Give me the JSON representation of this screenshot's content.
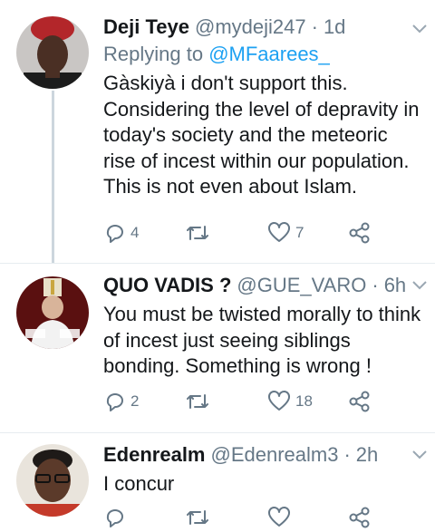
{
  "tweets": [
    {
      "name": "Deji Teye",
      "handle": "@mydeji247",
      "time": "1d",
      "replying_prefix": "Replying to ",
      "replying_handle": "@MFaarees_",
      "text": "Gàskiyà i don't support this. Considering the level of depravity in today's society and the meteoric rise of incest within our population. This is not even about Islam.",
      "replies": "4",
      "retweets": "",
      "likes": "7"
    },
    {
      "name": "QUO VADIS ?",
      "handle": "@GUE_VARO",
      "time": "6h",
      "text": "You must be twisted morally to think of incest just seeing siblings bonding.  Something is wrong !",
      "replies": "2",
      "retweets": "",
      "likes": "18"
    },
    {
      "name": "Edenrealm",
      "handle": "@Edenrealm3",
      "time": "2h",
      "text": "I concur",
      "replies": "",
      "retweets": "",
      "likes": ""
    }
  ],
  "separator": "·",
  "icons": {
    "reply": "reply-icon",
    "retweet": "retweet-icon",
    "like": "heart-icon",
    "share": "share-icon",
    "menu": "chevron-down-icon"
  },
  "colors": {
    "text": "#14171a",
    "muted": "#657786",
    "link": "#1da1f2",
    "thread_line": "#ccd6dd",
    "divider": "#e6ecf0"
  }
}
